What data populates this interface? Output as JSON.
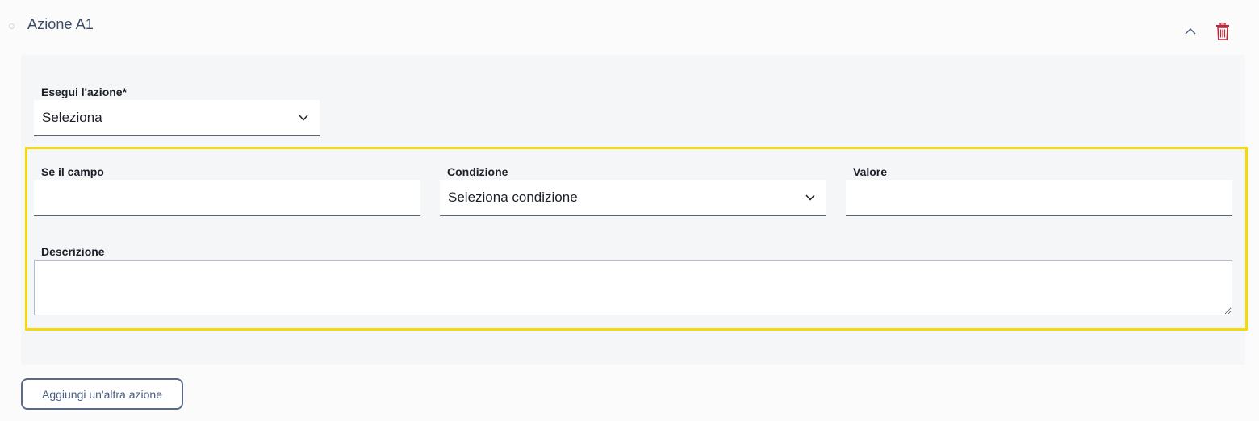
{
  "action": {
    "title": "Azione A1",
    "collapse_icon": "chevron-up-icon",
    "delete_icon": "trash-icon"
  },
  "execute": {
    "label": "Esegui l'azione*",
    "value": "Seleziona"
  },
  "condition_row": {
    "field_label": "Se il campo",
    "field_value": "",
    "condition_label": "Condizione",
    "condition_value": "Seleziona condizione",
    "value_label": "Valore",
    "value_value": ""
  },
  "description": {
    "label": "Descrizione",
    "value": ""
  },
  "add_button": {
    "label": "Aggiungi un'altra azione"
  },
  "colors": {
    "title": "#3b4a66",
    "delete": "#c0283a",
    "highlight": "#f5d90a",
    "button_border": "#5c6a89"
  }
}
